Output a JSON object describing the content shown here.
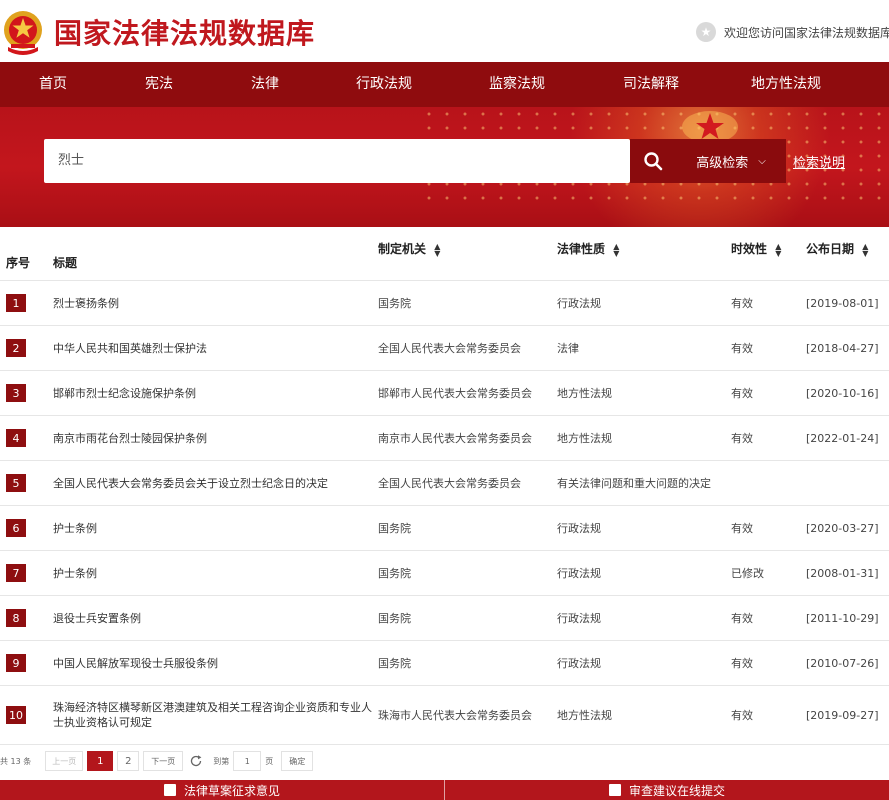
{
  "header": {
    "site_title": "国家法律法规数据库",
    "welcome_text": "欢迎您访问国家法律法规数据库"
  },
  "nav": {
    "items": [
      "首页",
      "宪法",
      "法律",
      "行政法规",
      "监察法规",
      "司法解释",
      "地方性法规"
    ]
  },
  "search": {
    "value": "烈士",
    "advanced_label": "高级检索",
    "help_label": "检索说明"
  },
  "table": {
    "headers": {
      "num": "序号",
      "title": "标题",
      "org": "制定机关",
      "type": "法律性质",
      "status": "时效性",
      "date": "公布日期"
    },
    "rows": [
      {
        "num": "1",
        "title": "烈士褒扬条例",
        "org": "国务院",
        "type": "行政法规",
        "status": "有效",
        "date": "[2019-08-01]"
      },
      {
        "num": "2",
        "title": "中华人民共和国英雄烈士保护法",
        "org": "全国人民代表大会常务委员会",
        "type": "法律",
        "status": "有效",
        "date": "[2018-04-27]"
      },
      {
        "num": "3",
        "title": "邯郸市烈士纪念设施保护条例",
        "org": "邯郸市人民代表大会常务委员会",
        "type": "地方性法规",
        "status": "有效",
        "date": "[2020-10-16]"
      },
      {
        "num": "4",
        "title": "南京市雨花台烈士陵园保护条例",
        "org": "南京市人民代表大会常务委员会",
        "type": "地方性法规",
        "status": "有效",
        "date": "[2022-01-24]"
      },
      {
        "num": "5",
        "title": "全国人民代表大会常务委员会关于设立烈士纪念日的决定",
        "org": "全国人民代表大会常务委员会",
        "type": "有关法律问题和重大问题的决定",
        "status": "",
        "date": ""
      },
      {
        "num": "6",
        "title": "护士条例",
        "org": "国务院",
        "type": "行政法规",
        "status": "有效",
        "date": "[2020-03-27]"
      },
      {
        "num": "7",
        "title": "护士条例",
        "org": "国务院",
        "type": "行政法规",
        "status": "已修改",
        "date": "[2008-01-31]"
      },
      {
        "num": "8",
        "title": "退役士兵安置条例",
        "org": "国务院",
        "type": "行政法规",
        "status": "有效",
        "date": "[2011-10-29]"
      },
      {
        "num": "9",
        "title": "中国人民解放军现役士兵服役条例",
        "org": "国务院",
        "type": "行政法规",
        "status": "有效",
        "date": "[2010-07-26]"
      },
      {
        "num": "10",
        "title": "珠海经济特区横琴新区港澳建筑及相关工程咨询企业资质和专业人士执业资格认可规定",
        "org": "珠海市人民代表大会常务委员会",
        "type": "地方性法规",
        "status": "有效",
        "date": "[2019-09-27]"
      }
    ]
  },
  "pagination": {
    "total_label": "共 13 条",
    "prev_label": "上一页",
    "page1": "1",
    "page2": "2",
    "next_label": "下一页",
    "goto_label": "到第",
    "goto_value": "1",
    "page_unit": "页",
    "confirm_label": "确定"
  },
  "footer": {
    "left_label": "法律草案征求意见",
    "right_label": "审查建议在线提交"
  },
  "colors": {
    "brand_red": "#c0181e",
    "nav_dark_red": "#8f0c0e",
    "badge_red": "#8e0e10"
  },
  "icons": [
    "national-emblem-icon",
    "star-badge-icon",
    "search-icon",
    "chevron-down-icon",
    "sort-icon",
    "refresh-icon",
    "draft-icon",
    "submit-icon"
  ]
}
